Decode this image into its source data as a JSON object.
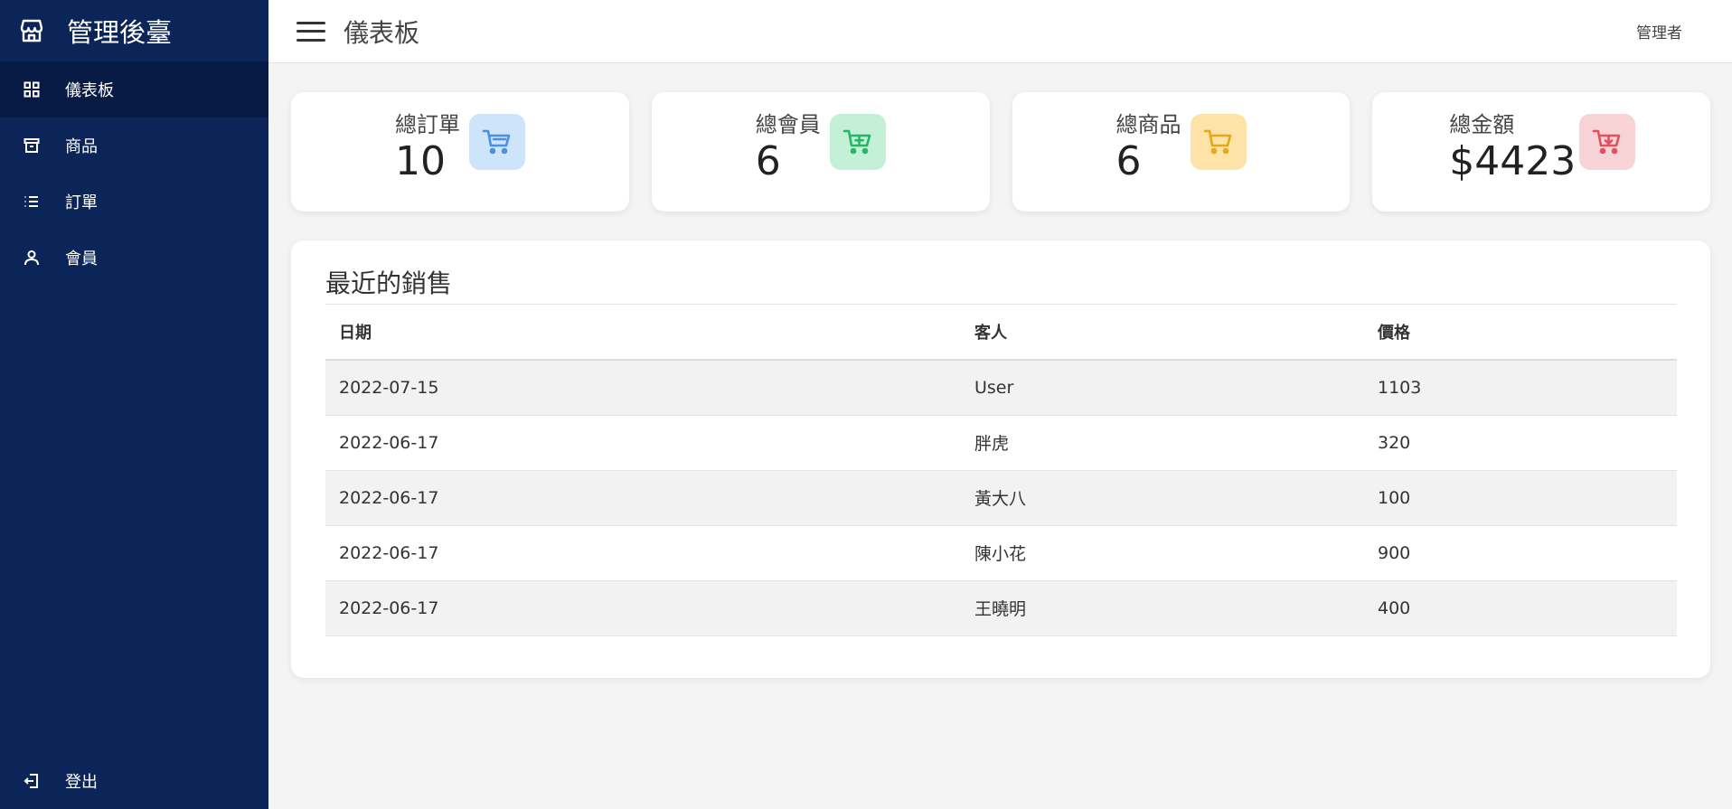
{
  "sidebar": {
    "brand_title": "管理後臺",
    "items": [
      {
        "label": "儀表板",
        "icon": "dashboard-icon",
        "active": true
      },
      {
        "label": "商品",
        "icon": "archive-icon"
      },
      {
        "label": "訂單",
        "icon": "list-icon"
      },
      {
        "label": "會員",
        "icon": "user-icon"
      }
    ],
    "logout_label": "登出"
  },
  "topbar": {
    "title": "儀表板",
    "user": "管理者"
  },
  "cards": [
    {
      "label": "總訂單",
      "value": "10",
      "icon": "cart-icon",
      "icon_bg": "#cde4fb",
      "icon_color": "#4a90e2"
    },
    {
      "label": "總會員",
      "value": "6",
      "icon": "cart-plus-icon",
      "icon_bg": "#c3f0d6",
      "icon_color": "#22b866"
    },
    {
      "label": "總商品",
      "value": "6",
      "icon": "cart-icon",
      "icon_bg": "#fde3a7",
      "icon_color": "#e6a817"
    },
    {
      "label": "總金額",
      "value": "$4423",
      "icon": "cart-download-icon",
      "icon_bg": "#f8d3d6",
      "icon_color": "#e0505e"
    }
  ],
  "sales": {
    "title": "最近的銷售",
    "columns": [
      "日期",
      "客人",
      "價格"
    ],
    "rows": [
      [
        "2022-07-15",
        "User",
        "1103"
      ],
      [
        "2022-06-17",
        "胖虎",
        "320"
      ],
      [
        "2022-06-17",
        "黃大八",
        "100"
      ],
      [
        "2022-06-17",
        "陳小花",
        "900"
      ],
      [
        "2022-06-17",
        "王曉明",
        "400"
      ]
    ]
  },
  "colors": {
    "sidebar_bg": "#0c2558",
    "sidebar_active": "#081b45"
  }
}
